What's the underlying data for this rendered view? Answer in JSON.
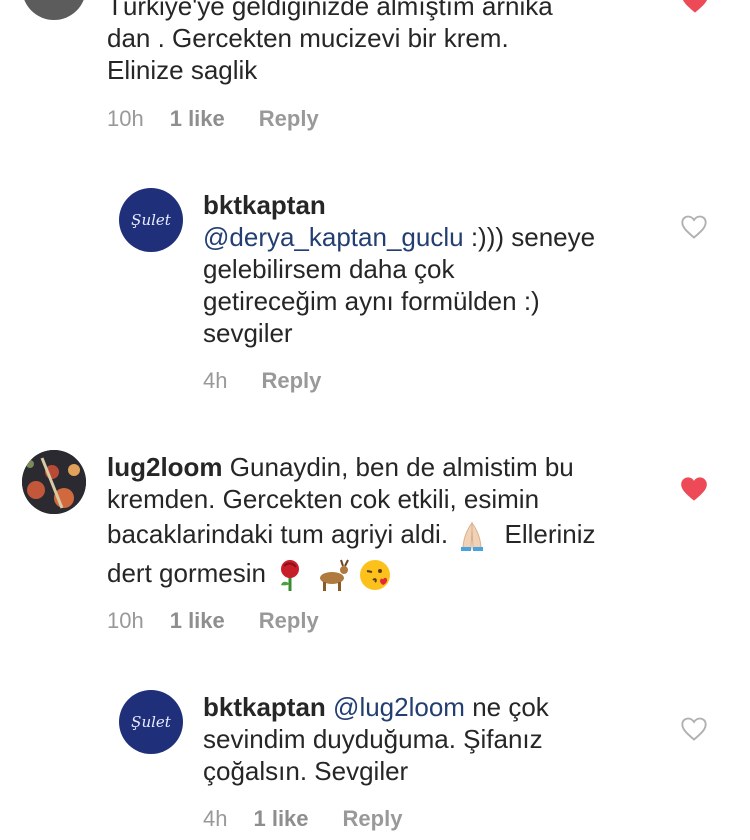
{
  "comments": [
    {
      "username": "",
      "text_lines": [
        "Türkiye'ye geldiğinizde almıştım arnika",
        "dan . Gercekten mucizevi bir krem.",
        "Elinize saglik"
      ],
      "time": "10h",
      "likes": "1 like",
      "reply_label": "Reply",
      "liked": true
    },
    {
      "username": "bktkaptan",
      "mention": "@derya_kaptan_guclu",
      "text_lines": [
        ":))) seneye",
        "gelebilirsem daha çok",
        "getireceğim aynı formülden :)",
        "sevgiler"
      ],
      "time": "4h",
      "reply_label": "Reply",
      "liked": false,
      "avatar_text": "Şulet"
    },
    {
      "username": "lug2loom",
      "text_lines": [
        "Gunaydin, ben de almistim bu",
        "kremden. Gercekten cok etkili, esimin",
        "bacaklarindaki tum agriyi aldi.",
        "Elleriniz",
        "dert gormesin"
      ],
      "time": "10h",
      "likes": "1 like",
      "reply_label": "Reply",
      "liked": true,
      "emojis": [
        "praying-hands",
        "rose",
        "deer",
        "kissing-face"
      ]
    },
    {
      "username": "bktkaptan",
      "mention": "@lug2loom",
      "text_lines": [
        "ne çok",
        "sevindim duyduğuma. Şifanız",
        "çoğalsın. Sevgiler"
      ],
      "time": "4h",
      "likes": "1 like",
      "reply_label": "Reply",
      "liked": false,
      "avatar_text": "Şulet"
    }
  ],
  "colors": {
    "text": "#262626",
    "mention": "#233f72",
    "meta": "#999999",
    "heart_liked": "#ed4956",
    "heart_outline": "#b0b0b0"
  }
}
